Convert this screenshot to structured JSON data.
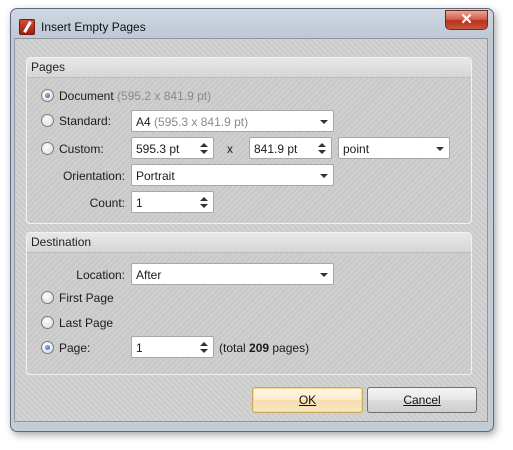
{
  "window": {
    "title": "Insert Empty Pages",
    "close_glyph": "✕"
  },
  "pages_group": {
    "header": "Pages",
    "document": {
      "label": "Document",
      "size": "(595.2 x 841.9 pt)",
      "selected": true
    },
    "standard": {
      "label": "Standard:",
      "value": "A4",
      "size": "(595.3 x 841.9 pt)",
      "selected": false
    },
    "custom": {
      "label": "Custom:",
      "width": "595.3 pt",
      "x_sep": "x",
      "height": "841.9 pt",
      "unit": "point",
      "selected": false
    },
    "orientation": {
      "label": "Orientation:",
      "value": "Portrait"
    },
    "count": {
      "label": "Count:",
      "value": "1"
    }
  },
  "destination_group": {
    "header": "Destination",
    "location": {
      "label": "Location:",
      "value": "After"
    },
    "first_page": {
      "label": "First Page",
      "selected": false
    },
    "last_page": {
      "label": "Last Page",
      "selected": false
    },
    "page": {
      "label": "Page:",
      "value": "1",
      "selected": true,
      "total_prefix": "(total ",
      "total_count": "209",
      "total_suffix": " pages)"
    }
  },
  "buttons": {
    "ok": "OK",
    "cancel": "Cancel"
  },
  "icons": {
    "app": "pdf-editor-icon",
    "close": "close-icon",
    "dropdown": "chevron-down-icon",
    "spin_up": "spin-up-icon",
    "spin_down": "spin-down-icon"
  },
  "colors": {
    "close_button": "#c8432f",
    "radio_checked": "#1a55b8",
    "default_button_border": "#c9a85a"
  }
}
